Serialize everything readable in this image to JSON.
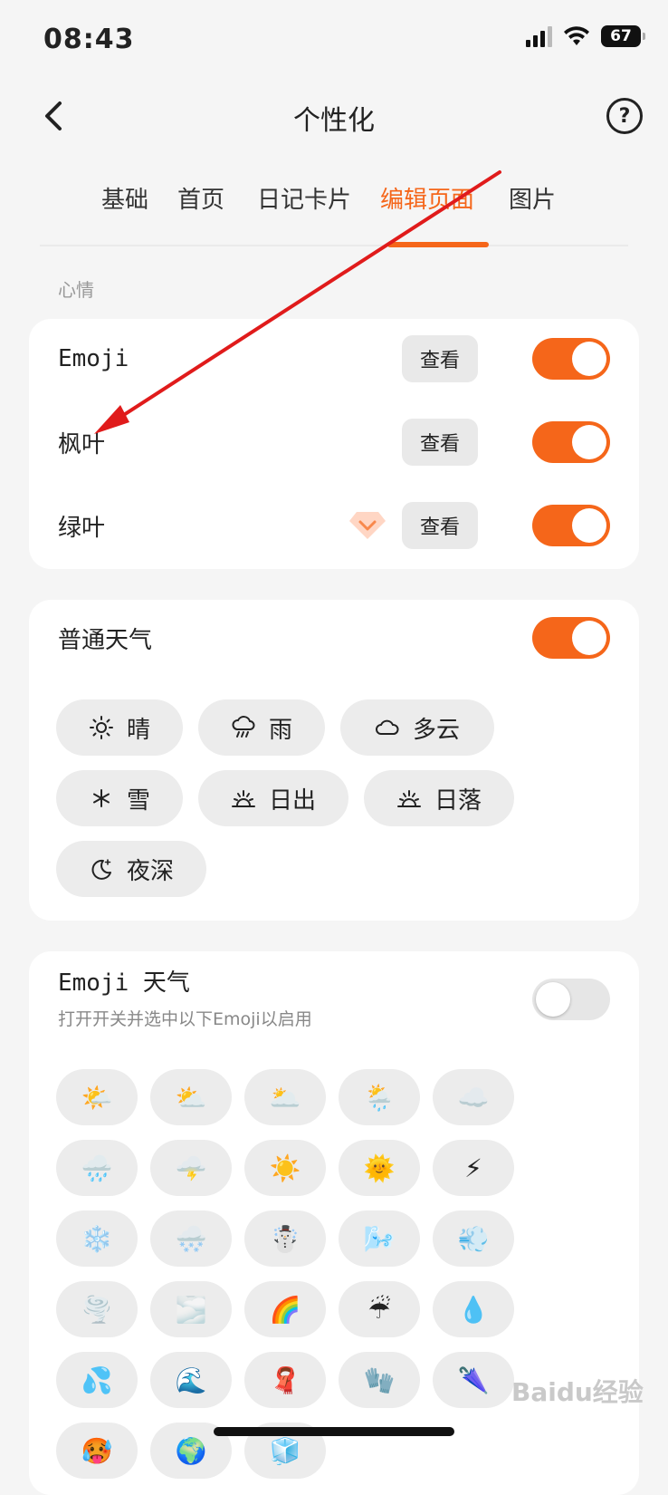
{
  "status": {
    "time": "08:43",
    "battery": "67"
  },
  "nav": {
    "title": "个性化",
    "help": "?"
  },
  "tabs": [
    {
      "label": "基础"
    },
    {
      "label": "首页"
    },
    {
      "label": "日记卡片"
    },
    {
      "label": "编辑页面",
      "active": true
    },
    {
      "label": "图片"
    }
  ],
  "mood": {
    "section_label": "心情",
    "view_label": "查看",
    "rows": [
      {
        "label": "Emoji",
        "enabled": true
      },
      {
        "label": "枫叶",
        "enabled": true
      },
      {
        "label": "绿叶",
        "enabled": true,
        "premium": true
      }
    ]
  },
  "normal_weather": {
    "label": "普通天气",
    "enabled": true,
    "chips": [
      {
        "label": "晴",
        "icon": "sun-icon"
      },
      {
        "label": "雨",
        "icon": "rain-cloud-icon"
      },
      {
        "label": "多云",
        "icon": "cloud-icon"
      },
      {
        "label": "雪",
        "icon": "snowflake-icon"
      },
      {
        "label": "日出",
        "icon": "sunrise-icon"
      },
      {
        "label": "日落",
        "icon": "sunset-icon"
      },
      {
        "label": "夜深",
        "icon": "moon-icon"
      }
    ]
  },
  "emoji_weather": {
    "label": "Emoji 天气",
    "hint": "打开开关并选中以下Emoji以启用",
    "enabled": false,
    "emojis": [
      "🌤️",
      "⛅",
      "🌥️",
      "🌦️",
      "☁️",
      "🌧️",
      "🌩️",
      "☀️",
      "🌞",
      "⚡",
      "❄️",
      "🌨️",
      "☃️",
      "🌬️",
      "💨",
      "🌪️",
      "🌫️",
      "🌈",
      "☔",
      "💧",
      "💦",
      "🌊",
      "🧣",
      "🧤",
      "🌂",
      "🥵",
      "🌍",
      "🧊"
    ]
  },
  "watermark": "Baidu经验",
  "colors": {
    "accent": "#f5661a",
    "annotation": "#e01b1b"
  }
}
